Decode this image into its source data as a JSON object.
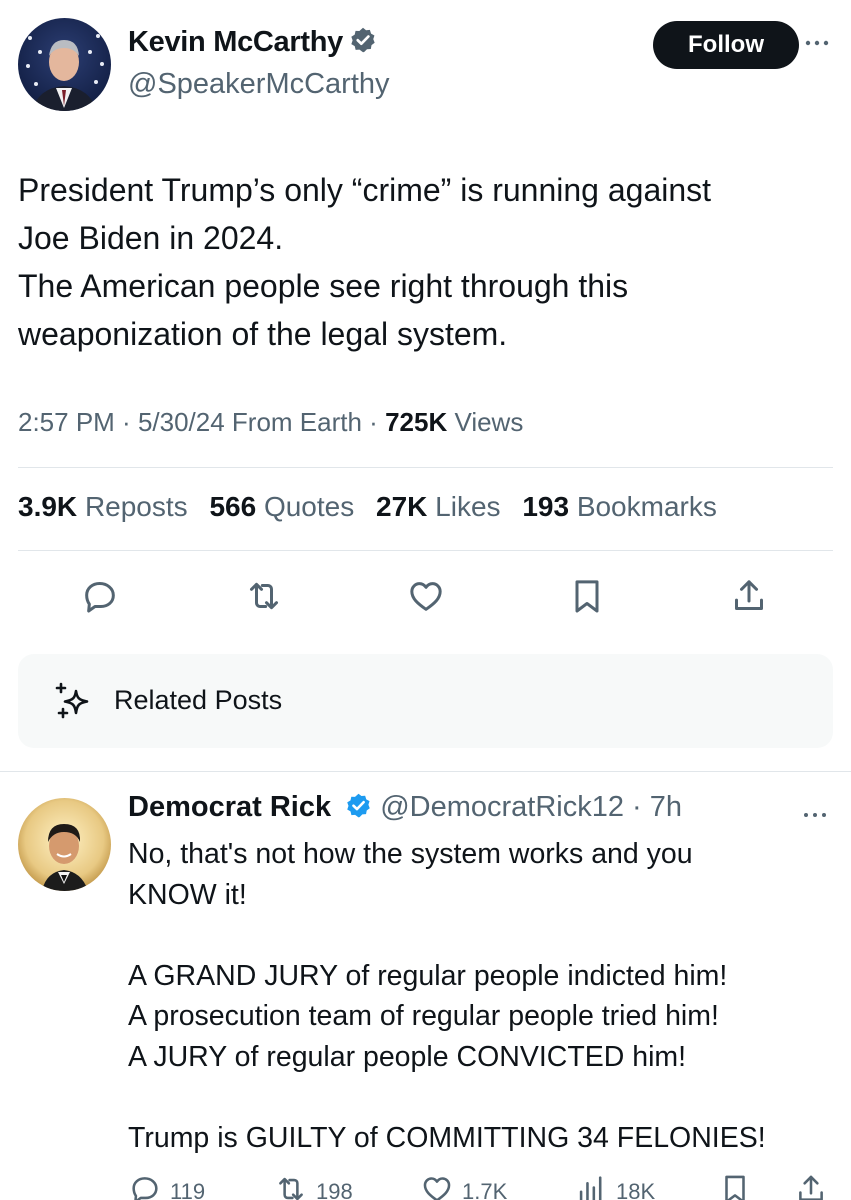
{
  "tweet": {
    "author_name": "Kevin McCarthy",
    "author_handle": "@SpeakerMcCarthy",
    "follow_label": "Follow",
    "text": "President Trump’s only “crime” is running against\nJoe Biden in 2024.\nThe American people see right through this\nweaponization of the legal system.",
    "time": "2:57 PM",
    "date": "5/30/24",
    "source": "From Earth",
    "views_count": "725K",
    "views_label": "Views",
    "stats": [
      {
        "count": "3.9K",
        "label": "Reposts"
      },
      {
        "count": "566",
        "label": "Quotes"
      },
      {
        "count": "27K",
        "label": "Likes"
      },
      {
        "count": "193",
        "label": "Bookmarks"
      }
    ],
    "actions": [
      "reply-icon",
      "repost-icon",
      "like-icon",
      "bookmark-icon",
      "share-icon"
    ]
  },
  "related": {
    "label": "Related Posts",
    "icon": "sparkle-icon"
  },
  "reply": {
    "author_name": "Democrat Rick",
    "author_handle": "@DemocratRick12",
    "time": "7h",
    "text": "No, that's not how the system works and you\nKNOW it!\n\nA GRAND JURY of regular people indicted him!\nA prosecution team of regular people tried him!\nA JURY of regular people CONVICTED him!\n\nTrump is GUILTY of COMMITTING 34 FELONIES!",
    "actions": [
      {
        "icon": "reply-icon",
        "count": "119"
      },
      {
        "icon": "repost-icon",
        "count": "198"
      },
      {
        "icon": "like-icon",
        "count": "1.7K"
      },
      {
        "icon": "views-icon",
        "count": "18K"
      },
      {
        "icon": "bookmark-icon",
        "count": ""
      },
      {
        "icon": "share-icon",
        "count": ""
      }
    ]
  },
  "colors": {
    "text": "#0f1419",
    "secondary": "#536471",
    "verified_blue": "#1d9bf0",
    "divider": "#e1e6ea",
    "related_bg": "#f7f9f9"
  }
}
